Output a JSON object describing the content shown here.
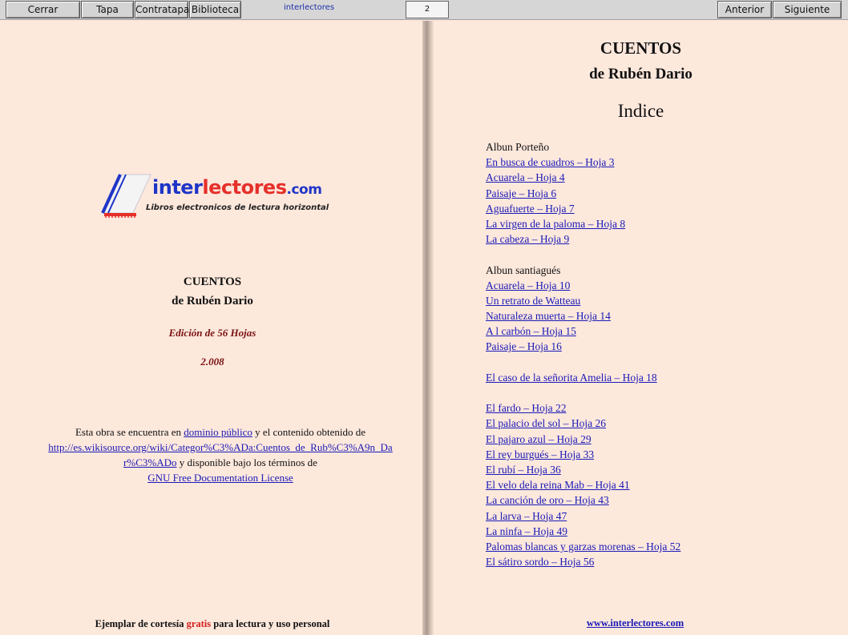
{
  "toolbar": {
    "cerrar": "Cerrar",
    "tapa": "Tapa",
    "contratapa": "Contratapa",
    "biblioteca": "Biblioteca",
    "brand": "interlectores",
    "page_number": "2",
    "anterior": "Anterior",
    "siguiente": "Siguiente"
  },
  "logo": {
    "word_blue": "inter",
    "word_red": "lectores",
    "word_suffix": ".com",
    "subtitle": "Libros electronicos de lectura horizontal"
  },
  "left": {
    "title": "CUENTOS",
    "author": "de Rubén Dario",
    "edition": "Edición de 56 Hojas",
    "year": "2.008",
    "notice_1": "Esta obra se encuentra en",
    "link_dominio": "dominio público",
    "notice_2": "y el contenido obtenido de",
    "link_wiki": "http://es.wikisource.org/wiki/Categor%C3%ADa:Cuentos_de_Rub%C3%A9n_Dar%C3%ADo",
    "notice_3": "y disponible bajo los términos de",
    "link_gnu": "GNU Free Documentation License",
    "footer_1": "Ejemplar de cortesía",
    "footer_gratis": "gratis",
    "footer_2": "para lectura y uso personal"
  },
  "right": {
    "title": "CUENTOS",
    "author": "de Rubén Dario",
    "indice": "Indice",
    "sections": [
      {
        "heading": "Albun Porteño",
        "items": [
          "En busca de  cuadros – Hoja 3",
          "Acuarela – Hoja 4",
          "Paisaje – Hoja 6",
          "Aguafuerte – Hoja 7",
          "La virgen de la paloma – Hoja 8",
          "La cabeza – Hoja 9"
        ]
      },
      {
        "heading": "Albun santiagués",
        "items": [
          "Acuarela – Hoja 10",
          "Un retrato de Watteau",
          "Naturaleza muerta – Hoja 14",
          "A l carbón – Hoja 15",
          "Paisaje – Hoja 16"
        ]
      },
      {
        "heading": "",
        "items": [
          "El caso de la señorita Amelia – Hoja 18"
        ]
      },
      {
        "heading": "",
        "items": [
          "El fardo – Hoja 22",
          "El palacio del sol – Hoja 26",
          "El pajaro azul – Hoja 29",
          "El rey burgués – Hoja 33",
          "El rubí – Hoja 36",
          "El velo dela reina Mab – Hoja 41",
          "La canción de oro – Hoja 43",
          "La larva – Hoja 47",
          "La ninfa – Hoja 49",
          "Palomas blancas y garzas morenas – Hoja 52",
          "El sátiro sordo – Hoja 56"
        ]
      }
    ],
    "footer_link": "www.interlectores.com"
  }
}
